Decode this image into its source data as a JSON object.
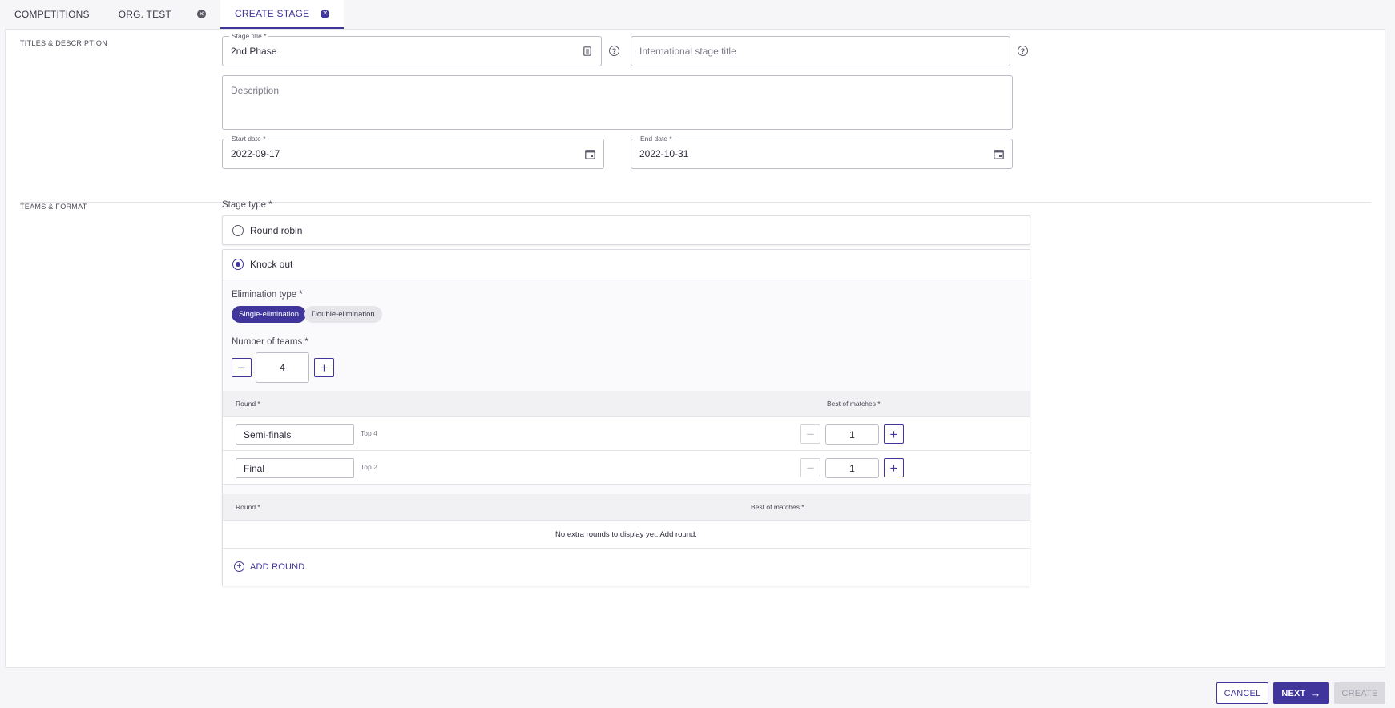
{
  "tabs": [
    {
      "label": "COMPETITIONS",
      "closable": false,
      "active": false
    },
    {
      "label": "ORG. TEST",
      "closable": true,
      "active": false
    },
    {
      "label": "CREATE STAGE",
      "closable": true,
      "active": true
    }
  ],
  "sections": {
    "titles": "TITLES & DESCRIPTION",
    "teams": "TEAMS & FORMAT"
  },
  "fields": {
    "stage_title": {
      "label": "Stage title *",
      "value": "2nd Phase"
    },
    "intl_title": {
      "placeholder": "International stage title"
    },
    "description": {
      "placeholder": "Description"
    },
    "start_date": {
      "label": "Start date *",
      "value": "2022-09-17"
    },
    "end_date": {
      "label": "End date *",
      "value": "2022-10-31"
    }
  },
  "stage_type": {
    "label": "Stage type *",
    "options": [
      "Round robin",
      "Knock out"
    ],
    "selected": "Knock out"
  },
  "elimination": {
    "label": "Elimination type *",
    "options": [
      "Single-elimination",
      "Double-elimination"
    ],
    "selected": "Single-elimination"
  },
  "teams": {
    "label": "Number of teams *",
    "value": "4"
  },
  "rounds_table": {
    "col_round": "Round *",
    "col_best": "Best of matches *",
    "rows": [
      {
        "name": "Semi-finals",
        "hint": "Top 4",
        "best_of": "1"
      },
      {
        "name": "Final",
        "hint": "Top 2",
        "best_of": "1"
      }
    ]
  },
  "extra_rounds_table": {
    "col_round": "Round *",
    "col_best": "Best of matches *",
    "empty": "No extra rounds to display yet. Add round."
  },
  "add_round": "ADD ROUND",
  "buttons": {
    "cancel": "CANCEL",
    "next": "NEXT",
    "create": "CREATE"
  },
  "colors": {
    "accent": "#3f359a",
    "background": "#f6f6f9"
  },
  "icons": [
    "close-icon",
    "clipboard-icon",
    "help-icon",
    "calendar-icon",
    "minus-icon",
    "plus-icon",
    "add-circle-icon",
    "arrow-right-icon"
  ]
}
